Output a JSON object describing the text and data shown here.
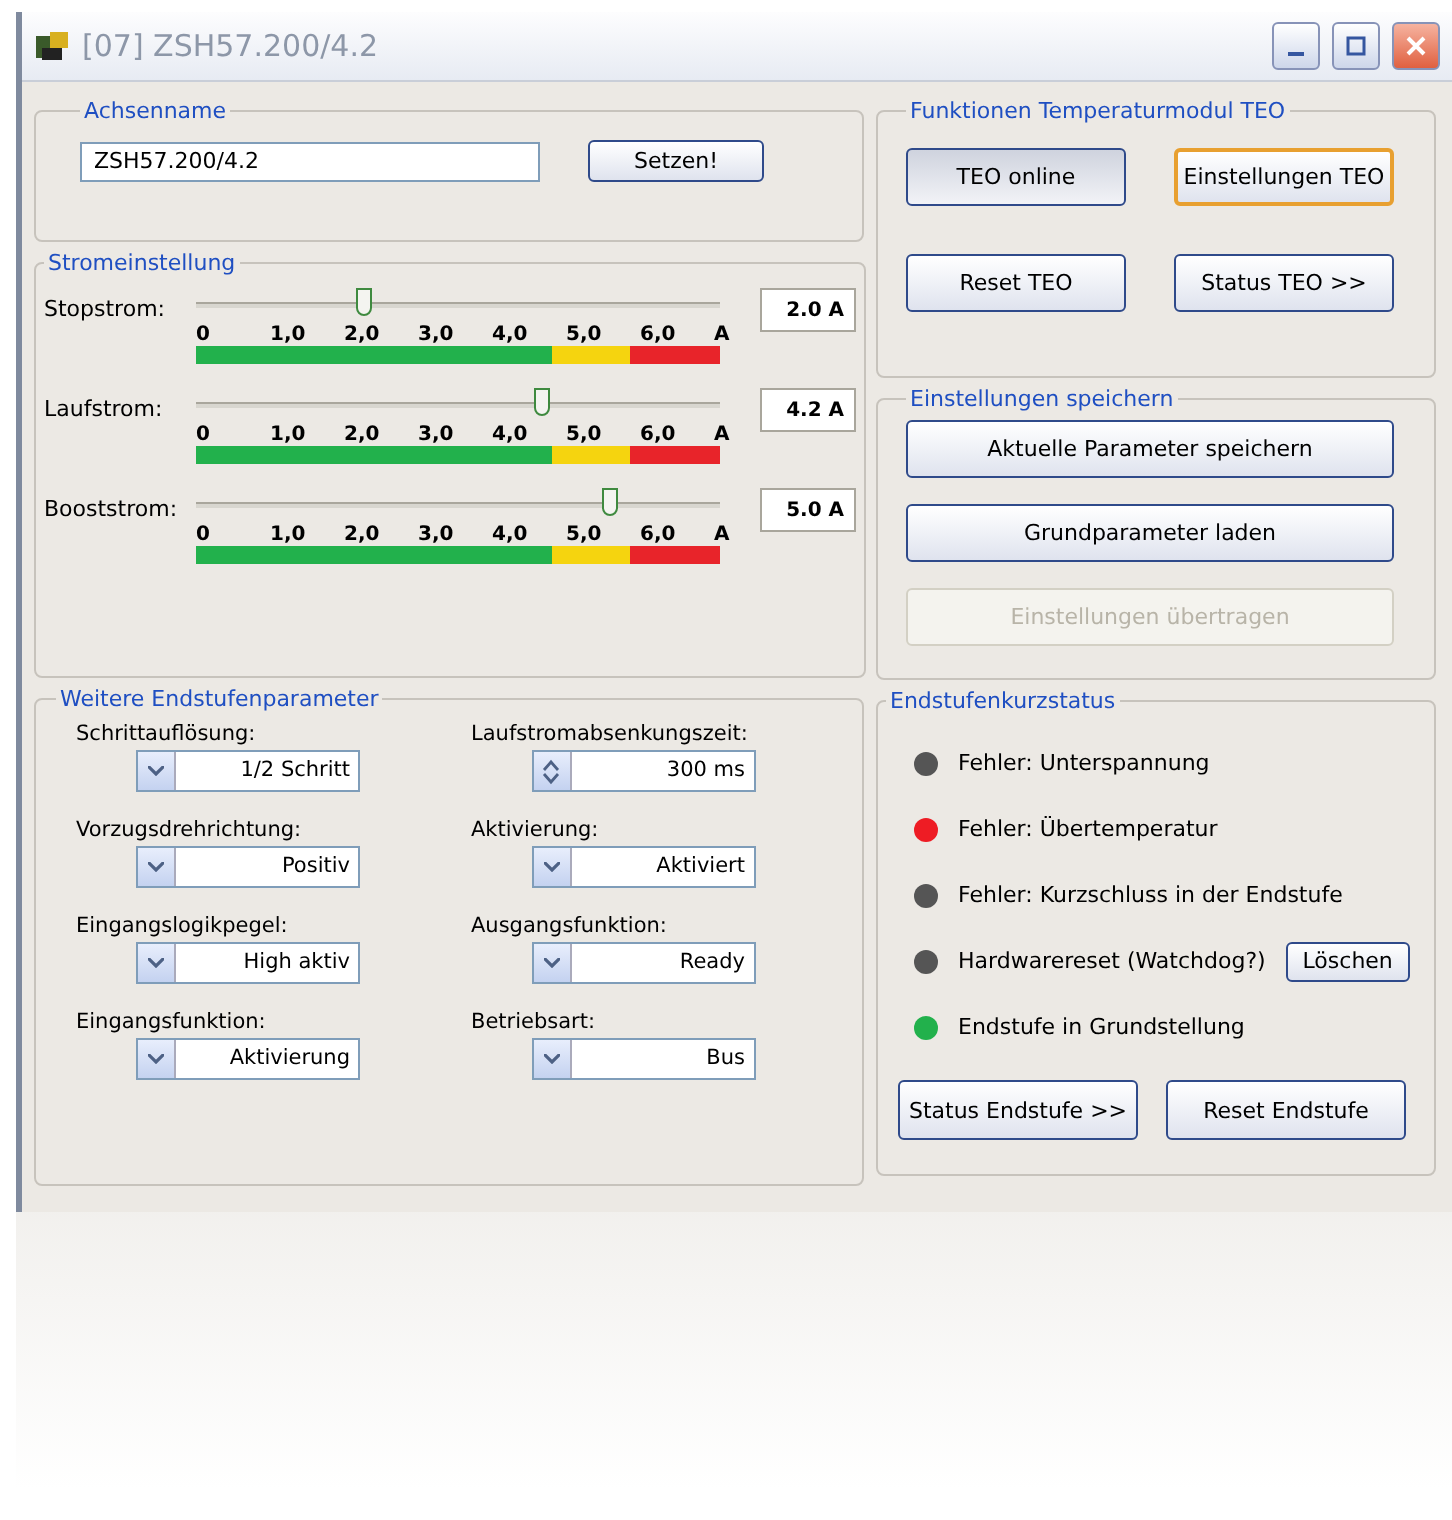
{
  "window": {
    "title": "[07] ZSH57.200/4.2"
  },
  "axis_name": {
    "legend": "Achsenname",
    "value": "ZSH57.200/4.2",
    "button": "Setzen!"
  },
  "current": {
    "legend": "Stromeinstellung",
    "sliders": [
      {
        "label": "Stopstrom:",
        "level": 0.32,
        "reading": "2.0 A",
        "scale": [
          "0",
          "1,0",
          "2,0",
          "3,0",
          "4,0",
          "5,0",
          "6,0"
        ],
        "unit": "A",
        "zones": [
          {
            "color": "#22b14c"
          },
          {
            "color": "#f5d40f"
          },
          {
            "color": "#e8242a"
          }
        ]
      },
      {
        "label": "Laufstrom:",
        "level": 0.66,
        "reading": "4.2 A",
        "scale": [
          "0",
          "1,0",
          "2,0",
          "3,0",
          "4,0",
          "5,0",
          "6,0"
        ],
        "unit": "A",
        "zones": [
          {
            "color": "#22b14c"
          },
          {
            "color": "#f5d40f"
          },
          {
            "color": "#e8242a"
          }
        ]
      },
      {
        "label": "Booststrom:",
        "level": 0.79,
        "reading": "5.0 A",
        "scale": [
          "0",
          "1,0",
          "2,0",
          "3,0",
          "4,0",
          "5,0",
          "6,0"
        ],
        "unit": "A",
        "zones": [
          {
            "color": "#22b14c"
          },
          {
            "color": "#f5d40f"
          },
          {
            "color": "#e8242a"
          }
        ]
      }
    ]
  },
  "params": {
    "legend": "Weitere Endstufenparameter",
    "fields": [
      {
        "label": "Schrittauflösung:",
        "kind": "dropdown",
        "value": "1/2 Schritt"
      },
      {
        "label": "Laufstromabsenkungszeit:",
        "kind": "spinner",
        "value": "300 ms"
      },
      {
        "label": "Vorzugsdrehrichtung:",
        "kind": "dropdown",
        "value": "Positiv"
      },
      {
        "label": "Aktivierung:",
        "kind": "dropdown",
        "value": "Aktiviert"
      },
      {
        "label": "Eingangslogikpegel:",
        "kind": "dropdown",
        "value": "High aktiv"
      },
      {
        "label": "Ausgangsfunktion:",
        "kind": "dropdown",
        "value": "Ready"
      },
      {
        "label": "Eingangsfunktion:",
        "kind": "dropdown",
        "value": "Aktivierung"
      },
      {
        "label": "Betriebsart:",
        "kind": "dropdown",
        "value": "Bus"
      }
    ]
  },
  "teo": {
    "legend": "Funktionen Temperaturmodul TEO",
    "buttons": [
      {
        "label": "TEO online",
        "pressed": true,
        "focused": false
      },
      {
        "label": "Einstellungen TEO",
        "pressed": false,
        "focused": true
      },
      {
        "label": "Reset TEO",
        "pressed": false,
        "focused": false
      },
      {
        "label": "Status TEO >>",
        "pressed": false,
        "focused": false
      }
    ]
  },
  "save": {
    "legend": "Einstellungen speichern",
    "buttons": [
      {
        "label": "Aktuelle Parameter speichern",
        "disabled": false
      },
      {
        "label": "Grundparameter laden",
        "disabled": false
      },
      {
        "label": "Einstellungen übertragen",
        "disabled": true
      }
    ]
  },
  "status": {
    "legend": "Endstufenkurzstatus",
    "items": [
      {
        "label": "Fehler: Unterspannung",
        "color": "#555555"
      },
      {
        "label": "Fehler: Übertemperatur",
        "color": "#ee1c24"
      },
      {
        "label": "Fehler: Kurzschluss in der Endstufe",
        "color": "#555555"
      },
      {
        "label": "Hardwarereset (Watchdog?)",
        "color": "#555555",
        "button": "Löschen"
      },
      {
        "label": "Endstufe in Grundstellung",
        "color": "#22b14c"
      }
    ],
    "buttons": [
      "Status Endstufe >>",
      "Reset Endstufe"
    ]
  }
}
